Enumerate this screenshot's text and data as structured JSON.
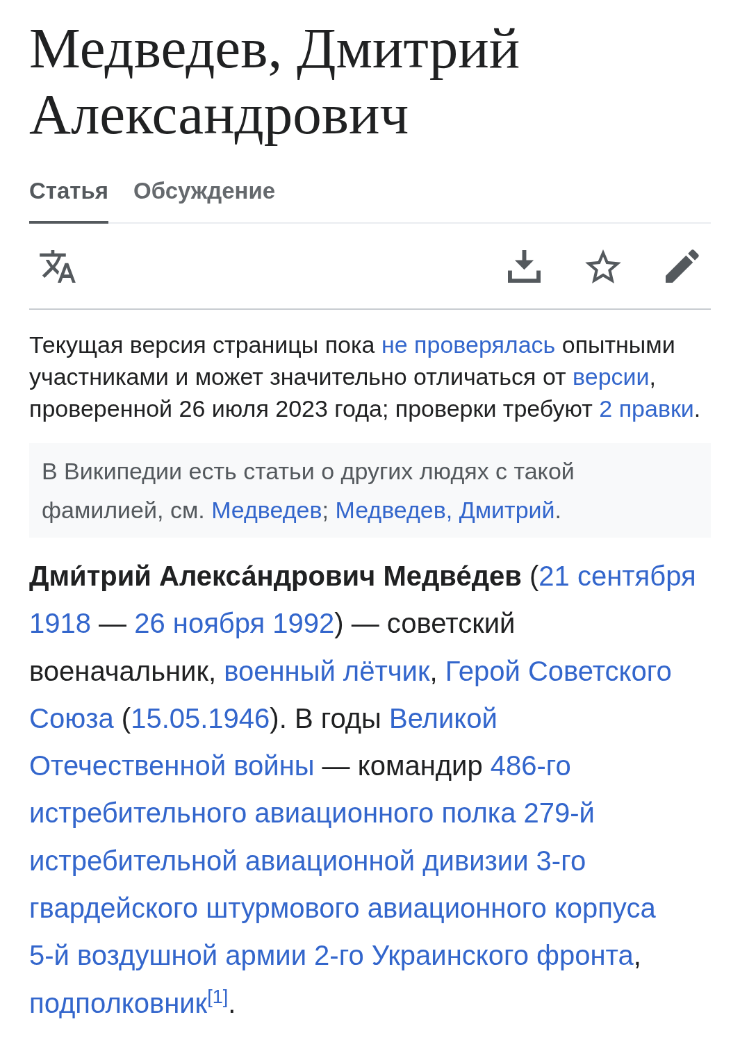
{
  "title": "Медведев, Дмитрий Александрович",
  "tabs": [
    {
      "label": "Статья",
      "selected": true
    },
    {
      "label": "Обсуждение",
      "selected": false
    }
  ],
  "toolbar": {
    "watched": false
  },
  "revision_notice": {
    "lines": [
      [
        {
          "kind": "text",
          "text": "Текущая версия страницы пока "
        },
        {
          "kind": "link",
          "text": "не проверялась"
        },
        {
          "kind": "text",
          "text": " опытными"
        }
      ],
      [
        {
          "kind": "text",
          "text": "участниками и может значительно отличаться от "
        },
        {
          "kind": "link",
          "text": "версии"
        },
        {
          "kind": "text",
          "text": ","
        }
      ],
      [
        {
          "kind": "text",
          "text": "проверенной 26 июля 2023 года; проверки требуют "
        },
        {
          "kind": "link",
          "text": "2 правки"
        },
        {
          "kind": "text",
          "text": "."
        }
      ]
    ]
  },
  "hatnote": {
    "lines": [
      [
        {
          "kind": "text",
          "text": "В Википедии есть статьи о других людях с такой"
        }
      ],
      [
        {
          "kind": "text",
          "text": "фамилией, см. "
        },
        {
          "kind": "link",
          "text": "Медведев"
        },
        {
          "kind": "text",
          "text": "; "
        },
        {
          "kind": "link",
          "text": "Медведев, Дмитрий"
        },
        {
          "kind": "text",
          "text": "."
        }
      ]
    ]
  },
  "lead_paragraph": {
    "lines": [
      [
        {
          "kind": "bold",
          "text": "Дми́трий Алекса́ндрович Медве́дев"
        },
        {
          "kind": "text",
          "text": " ("
        },
        {
          "kind": "link",
          "text": "21 сентября"
        }
      ],
      [
        {
          "kind": "link",
          "text": "1918"
        },
        {
          "kind": "text",
          "text": " — "
        },
        {
          "kind": "link",
          "text": "26 ноября 1992"
        },
        {
          "kind": "text",
          "text": ") — советский"
        }
      ],
      [
        {
          "kind": "text",
          "text": "военачальник, "
        },
        {
          "kind": "link",
          "text": "военный лётчик"
        },
        {
          "kind": "text",
          "text": ", "
        },
        {
          "kind": "link",
          "text": "Герой Советского"
        }
      ],
      [
        {
          "kind": "link",
          "text": "Союза"
        },
        {
          "kind": "text",
          "text": " ("
        },
        {
          "kind": "link",
          "text": "15.05.1946"
        },
        {
          "kind": "text",
          "text": "). В годы "
        },
        {
          "kind": "link",
          "text": "Великой"
        }
      ],
      [
        {
          "kind": "link",
          "text": "Отечественной войны"
        },
        {
          "kind": "text",
          "text": " — командир "
        },
        {
          "kind": "link",
          "text": "486-го"
        }
      ],
      [
        {
          "kind": "link",
          "text": "истребительного авиационного полка 279-й"
        }
      ],
      [
        {
          "kind": "link",
          "text": "истребительной авиационной дивизии 3-го"
        }
      ],
      [
        {
          "kind": "link",
          "text": "гвардейского штурмового авиационного корпуса"
        }
      ],
      [
        {
          "kind": "link",
          "text": "5-й воздушной армии 2-го Украинского фронта"
        },
        {
          "kind": "text",
          "text": ","
        }
      ],
      [
        {
          "kind": "link",
          "text": "подполковник"
        },
        {
          "kind": "ref",
          "text": "[1]"
        },
        {
          "kind": "text",
          "text": "."
        }
      ]
    ]
  }
}
